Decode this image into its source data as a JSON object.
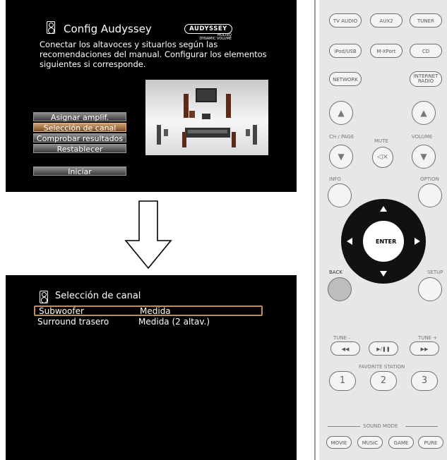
{
  "screen1": {
    "title": "Config Audyssey",
    "description": "Conectar los altavoces y situarlos según las recomendaciones del manual. Configurar los elementos siguientes si corresponde.",
    "logo": {
      "main": "AUDYSSEY",
      "sub1": "MULTEQ",
      "sub2": "DYNAMIC VOLUME"
    },
    "menu": [
      "Asignar amplif.",
      "Selección de canal",
      "Comprobar resultados",
      "Restablecer"
    ],
    "start_button": "Iniciar"
  },
  "screen2": {
    "title": "Selección de canal",
    "rows": [
      {
        "key": "Subwoofer",
        "value": "Medida"
      },
      {
        "key": "Surround trasero",
        "value": "Medida (2 altav.)"
      }
    ]
  },
  "remote": {
    "row1": [
      "TV AUDIO",
      "AUX2",
      "TUNER"
    ],
    "row2": [
      "iPod/USB",
      "M-XPort",
      "CD"
    ],
    "row3": [
      "NETWORK",
      "INTERNET RADIO"
    ],
    "ch_page": "CH / PAGE",
    "mute": "MUTE",
    "volume": "VOLUME",
    "info": "INFO",
    "option": "OPTION",
    "enter": "ENTER",
    "back": "BACK",
    "setup": "SETUP",
    "tune_minus": "TUNE –",
    "tune_plus": "TUNE +",
    "favorite_station": "FAVORITE STATION",
    "numbers": [
      "1",
      "2",
      "3"
    ],
    "sound_mode": "SOUND MODE",
    "modes": [
      "MOVIE",
      "MUSIC",
      "GAME",
      "PURE"
    ]
  }
}
